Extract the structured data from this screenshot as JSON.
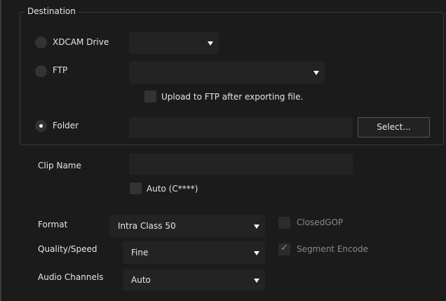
{
  "destination": {
    "legend": "Destination",
    "xdcam": {
      "label": "XDCAM Drive",
      "selected": false,
      "value": ""
    },
    "ftp": {
      "label": "FTP",
      "selected": false,
      "value": "",
      "upload_label": "Upload to FTP after exporting file.",
      "upload_checked": false
    },
    "folder": {
      "label": "Folder",
      "selected": true,
      "value": "",
      "select_button": "Select..."
    }
  },
  "clip_name": {
    "label": "Clip Name",
    "value": "",
    "auto_label": "Auto (C****)",
    "auto_checked": false
  },
  "format": {
    "label": "Format",
    "value": "Intra Class 50"
  },
  "quality_speed": {
    "label": "Quality/Speed",
    "value": "Fine"
  },
  "audio_channels": {
    "label": "Audio Channels",
    "value": "Auto"
  },
  "closed_gop": {
    "label": "ClosedGOP",
    "checked": false,
    "enabled": false
  },
  "segment_encode": {
    "label": "Segment Encode",
    "checked": true,
    "enabled": false
  }
}
